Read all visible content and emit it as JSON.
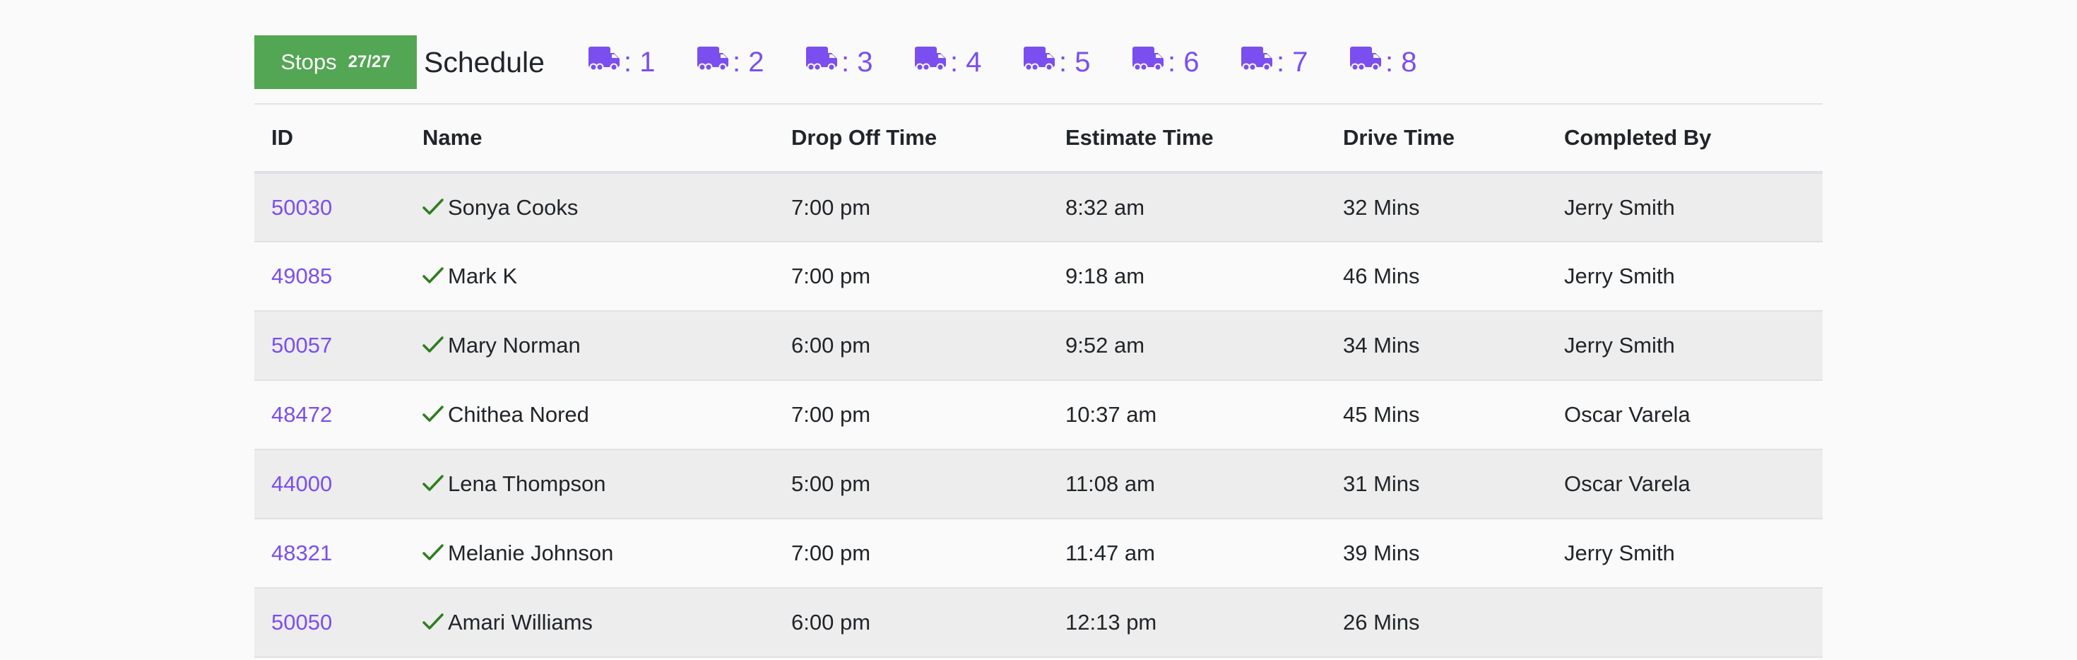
{
  "header": {
    "stops_label": "Stops",
    "stops_count": "27/27",
    "title": "Schedule",
    "trucks": [
      {
        "icon": "truck-icon",
        "label": ": 1"
      },
      {
        "icon": "truck-icon",
        "label": ": 2"
      },
      {
        "icon": "truck-icon",
        "label": ": 3"
      },
      {
        "icon": "truck-icon",
        "label": ": 4"
      },
      {
        "icon": "truck-icon",
        "label": ": 5"
      },
      {
        "icon": "truck-icon",
        "label": ": 6"
      },
      {
        "icon": "truck-icon",
        "label": ": 7"
      },
      {
        "icon": "truck-icon",
        "label": ": 8"
      }
    ]
  },
  "colors": {
    "accent": "#7b4ef0",
    "stops_badge": "#53a653",
    "check": "#2e7d1f"
  },
  "table": {
    "columns": [
      "ID",
      "Name",
      "Drop Off Time",
      "Estimate Time",
      "Drive Time",
      "Completed By"
    ],
    "rows": [
      {
        "id": "50030",
        "completed": true,
        "name": "Sonya Cooks",
        "drop_off": "7:00 pm",
        "estimate": "8:32 am",
        "drive": "32 Mins",
        "completed_by": "Jerry Smith"
      },
      {
        "id": "49085",
        "completed": true,
        "name": "Mark K",
        "drop_off": "7:00 pm",
        "estimate": "9:18 am",
        "drive": "46 Mins",
        "completed_by": "Jerry Smith"
      },
      {
        "id": "50057",
        "completed": true,
        "name": "Mary Norman",
        "drop_off": "6:00 pm",
        "estimate": "9:52 am",
        "drive": "34 Mins",
        "completed_by": "Jerry Smith"
      },
      {
        "id": "48472",
        "completed": true,
        "name": "Chithea Nored",
        "drop_off": "7:00 pm",
        "estimate": "10:37 am",
        "drive": "45 Mins",
        "completed_by": "Oscar Varela"
      },
      {
        "id": "44000",
        "completed": true,
        "name": "Lena Thompson",
        "drop_off": "5:00 pm",
        "estimate": "11:08 am",
        "drive": "31 Mins",
        "completed_by": "Oscar Varela"
      },
      {
        "id": "48321",
        "completed": true,
        "name": "Melanie Johnson",
        "drop_off": "7:00 pm",
        "estimate": "11:47 am",
        "drive": "39 Mins",
        "completed_by": "Jerry Smith"
      },
      {
        "id": "50050",
        "completed": true,
        "name": "Amari Williams",
        "drop_off": "6:00 pm",
        "estimate": "12:13 pm",
        "drive": "26 Mins",
        "completed_by": ""
      }
    ]
  }
}
